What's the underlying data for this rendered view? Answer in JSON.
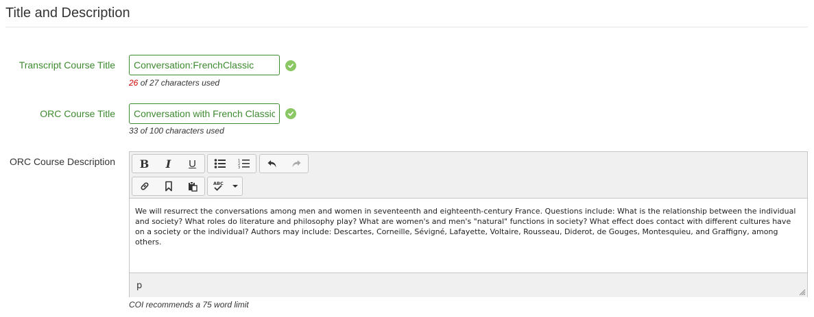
{
  "section": {
    "title": "Title and Description"
  },
  "transcript_title": {
    "label": "Transcript Course Title",
    "value": "Conversation:FrenchClassic",
    "count_used": "26",
    "count_rest": " of 27 characters used"
  },
  "orc_title": {
    "label": "ORC Course Title",
    "value": "Conversation with French Classics",
    "help": "33 of 100 characters used"
  },
  "orc_description": {
    "label": "ORC Course Description",
    "body": "We will resurrect the conversations among men and women in seventeenth and eighteenth-century France.  Questions include: What is the relationship between the individual and society? What roles do literature and philosophy play? What are women's and men's \"natural\" functions in society? What effect does contact with different cultures have on a society or the individual?  Authors may include:  Descartes, Corneille, Sévigné, Lafayette, Voltaire, Rousseau, Diderot, de Gouges, Montesquieu, and Graffigny, among others.",
    "path": "p",
    "help": "COI recommends a 75 word limit",
    "toolbar": {
      "bold": "B",
      "italic": "I",
      "underline": "U"
    }
  },
  "colors": {
    "success": "#3c8a2e",
    "check": "#8cc765",
    "count_warning": "#d00000"
  }
}
